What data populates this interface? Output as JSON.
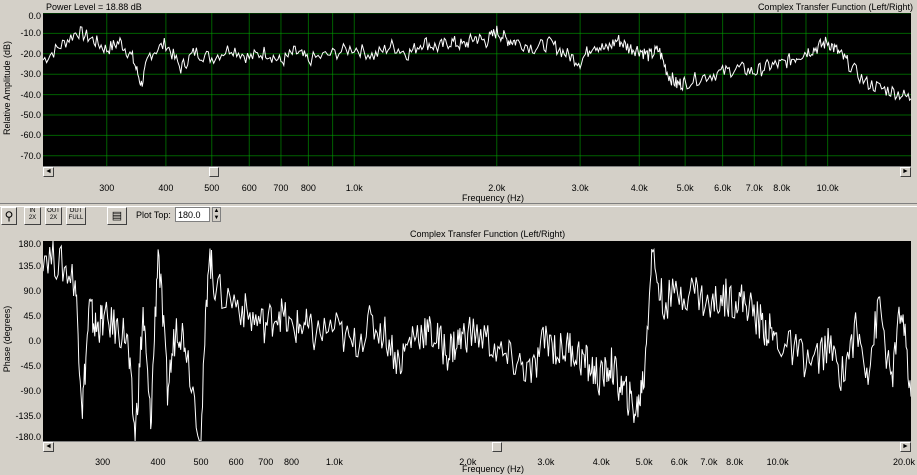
{
  "top": {
    "power_level": "Power Level = 18.88 dB",
    "title": "Complex Transfer Function (Left/Right)",
    "ylabel": "Relative Amplitude (dB)",
    "xlabel": "Frequency (Hz)",
    "yticks": [
      "0.0",
      "-10.0",
      "-20.0",
      "-30.0",
      "-40.0",
      "-50.0",
      "-60.0",
      "-70.0"
    ],
    "xticks": [
      "300",
      "400",
      "500",
      "600",
      "700",
      "800",
      "1.0k",
      "2.0k",
      "3.0k",
      "4.0k",
      "5.0k",
      "6.0k",
      "7.0k",
      "8.0k",
      "10.0k"
    ],
    "scroll_left": "◄",
    "scroll_right": "►"
  },
  "toolbar": {
    "zoom_icon": "magnifier-icon",
    "in_label": "IN",
    "in_zoom": "2X",
    "out_label": "OUT",
    "out_zoom": "2X",
    "full_label": "OUT",
    "full_zoom": "FULL",
    "plot_top_label": "Plot Top:",
    "plot_top_value": "180.0"
  },
  "bottom": {
    "title": "Complex Transfer Function (Left/Right)",
    "ylabel": "Phase (degrees)",
    "xlabel": "Frequency (Hz)",
    "yticks": [
      "180.0",
      "135.0",
      "90.0",
      "45.0",
      "0.0",
      "-45.0",
      "-90.0",
      "-135.0",
      "-180.0"
    ],
    "xticks": [
      "300",
      "400",
      "500",
      "600",
      "700",
      "800",
      "1.0k",
      "2.0k",
      "3.0k",
      "4.0k",
      "5.0k",
      "6.0k",
      "7.0k",
      "8.0k",
      "10.0k",
      "20.0k"
    ],
    "scroll_left": "◄",
    "scroll_right": "►"
  },
  "chart_data": [
    {
      "type": "line",
      "title": "Complex Transfer Function (Left/Right)",
      "xlabel": "Frequency (Hz)",
      "ylabel": "Relative Amplitude (dB)",
      "xscale": "log",
      "xlim": [
        220,
        15000
      ],
      "ylim": [
        -75,
        0
      ],
      "grid": true,
      "series": [
        {
          "x": [
            220,
            240,
            260,
            280,
            300,
            320,
            340,
            355,
            370,
            400,
            430,
            460,
            500,
            550,
            600,
            650,
            700,
            750,
            800,
            900,
            1000,
            1100,
            1200,
            1300,
            1400,
            1500,
            1600,
            1700,
            1800,
            1900,
            2000,
            2100,
            2200,
            2400,
            2600,
            2800,
            3000,
            3200,
            3400,
            3600,
            3800,
            4000,
            4200,
            4400,
            4600,
            4800,
            5000,
            5500,
            6000,
            6500,
            7000,
            7500,
            8000,
            8500,
            9000,
            9500,
            10000,
            10500,
            11000,
            12000,
            13000,
            14000,
            15000
          ],
          "y": [
            -23,
            -16,
            -9,
            -13,
            -18,
            -14,
            -22,
            -35,
            -20,
            -15,
            -27,
            -19,
            -22,
            -17,
            -22,
            -19,
            -24,
            -19,
            -23,
            -20,
            -17,
            -21,
            -16,
            -20,
            -14,
            -17,
            -14,
            -16,
            -12,
            -14,
            -9,
            -13,
            -14,
            -17,
            -15,
            -20,
            -24,
            -15,
            -18,
            -13,
            -17,
            -18,
            -21,
            -18,
            -30,
            -35,
            -34,
            -31,
            -29,
            -27,
            -29,
            -26,
            -25,
            -22,
            -19,
            -17,
            -14,
            -19,
            -24,
            -34,
            -37,
            -39,
            -42
          ]
        }
      ]
    },
    {
      "type": "line",
      "title": "Complex Transfer Function (Left/Right)",
      "xlabel": "Frequency (Hz)",
      "ylabel": "Phase (degrees)",
      "xscale": "log",
      "xlim": [
        220,
        20000
      ],
      "ylim": [
        -180,
        180
      ],
      "grid": false,
      "series": [
        {
          "x": [
            220,
            240,
            260,
            270,
            280,
            290,
            300,
            320,
            340,
            355,
            370,
            385,
            400,
            420,
            440,
            460,
            500,
            520,
            540,
            600,
            650,
            700,
            750,
            800,
            850,
            900,
            1000,
            1100,
            1200,
            1300,
            1400,
            1500,
            1600,
            1700,
            1800,
            1900,
            2000,
            2200,
            2400,
            2600,
            2800,
            3000,
            3200,
            3400,
            3600,
            3800,
            4000,
            4200,
            4400,
            4600,
            4800,
            5000,
            5200,
            5500,
            6000,
            6500,
            7000,
            7500,
            8000,
            8500,
            9000,
            9500,
            10000,
            11000,
            12000,
            13000,
            14000,
            15000,
            16000,
            17000,
            18000,
            19000,
            20000
          ],
          "y": [
            160,
            140,
            110,
            -120,
            60,
            20,
            40,
            25,
            10,
            -175,
            50,
            -150,
            170,
            -90,
            30,
            5,
            -175,
            160,
            90,
            70,
            40,
            30,
            55,
            20,
            30,
            10,
            25,
            -10,
            30,
            15,
            -40,
            10,
            20,
            5,
            -20,
            0,
            15,
            5,
            -30,
            -40,
            -60,
            10,
            -20,
            -10,
            -30,
            -50,
            -70,
            -40,
            -80,
            -100,
            -130,
            -60,
            160,
            70,
            85,
            95,
            60,
            80,
            75,
            70,
            40,
            20,
            0,
            -20,
            -40,
            -10,
            -60,
            20,
            -50,
            70,
            -80,
            60,
            -100
          ]
        }
      ]
    }
  ]
}
